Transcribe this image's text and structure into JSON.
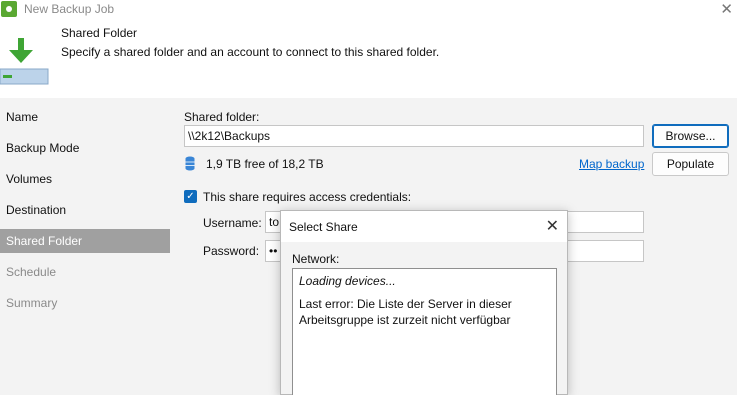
{
  "window": {
    "title": "New Backup Job",
    "close_glyph": "✕"
  },
  "header": {
    "title": "Shared Folder",
    "description": "Specify a shared folder and an account to connect to this shared folder.",
    "icon": "download-arrow-icon"
  },
  "sidebar": {
    "items": [
      {
        "label": "Name",
        "state": "normal"
      },
      {
        "label": "Backup Mode",
        "state": "normal"
      },
      {
        "label": "Volumes",
        "state": "normal"
      },
      {
        "label": "Destination",
        "state": "normal"
      },
      {
        "label": "Shared Folder",
        "state": "active"
      },
      {
        "label": "Schedule",
        "state": "disabled"
      },
      {
        "label": "Summary",
        "state": "disabled"
      }
    ]
  },
  "main": {
    "shared_folder_label": "Shared folder:",
    "shared_folder_value": "\\\\2k12\\Backups",
    "browse_label": "Browse...",
    "free_space": "1,9 TB free of 18,2 TB",
    "map_backup_label": "Map backup",
    "populate_label": "Populate",
    "credentials_checkbox_label": "This share requires access credentials:",
    "credentials_checked": true,
    "username_label": "Username:",
    "username_value": "to",
    "password_label": "Password:",
    "password_value": "••"
  },
  "dialog": {
    "title": "Select Share",
    "close_glyph": "✕",
    "network_label": "Network:",
    "loading_text": "Loading devices...",
    "error_text": "Last error: Die Liste der Server in dieser Arbeitsgruppe ist zurzeit nicht verfügbar"
  },
  "colors": {
    "accent": "#0f6cbd",
    "sidebar_active": "#a0a0a0",
    "link": "#0066cc",
    "app_green": "#5aa832"
  }
}
